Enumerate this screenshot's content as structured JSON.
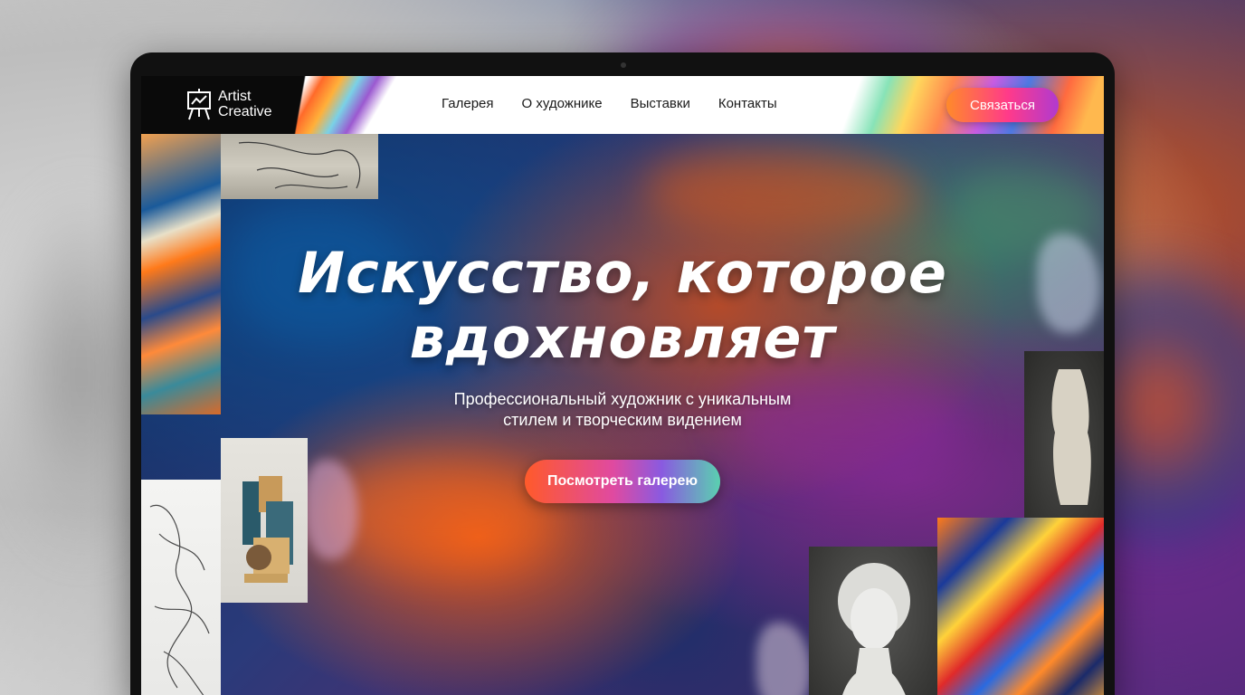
{
  "brand": {
    "line1": "Artist",
    "line2": "Creative",
    "logo_icon": "easel-icon"
  },
  "nav": {
    "items": [
      {
        "label": "Галерея"
      },
      {
        "label": "О художнике"
      },
      {
        "label": "Выставки"
      },
      {
        "label": "Контакты"
      }
    ],
    "cta_label": "Связаться"
  },
  "hero": {
    "title_line1": "Искусство, которое",
    "title_line2": "вдохновляет",
    "subtitle_line1": "Профессиональный художник с уникальным",
    "subtitle_line2": "стилем и творческим видением",
    "button_label": "Посмотреть галерею"
  },
  "colors": {
    "header_bg": "#ffffff",
    "cta_gradient_start": "#ff8a2a",
    "cta_gradient_end": "#b03ad0",
    "hero_text": "#ffffff"
  }
}
